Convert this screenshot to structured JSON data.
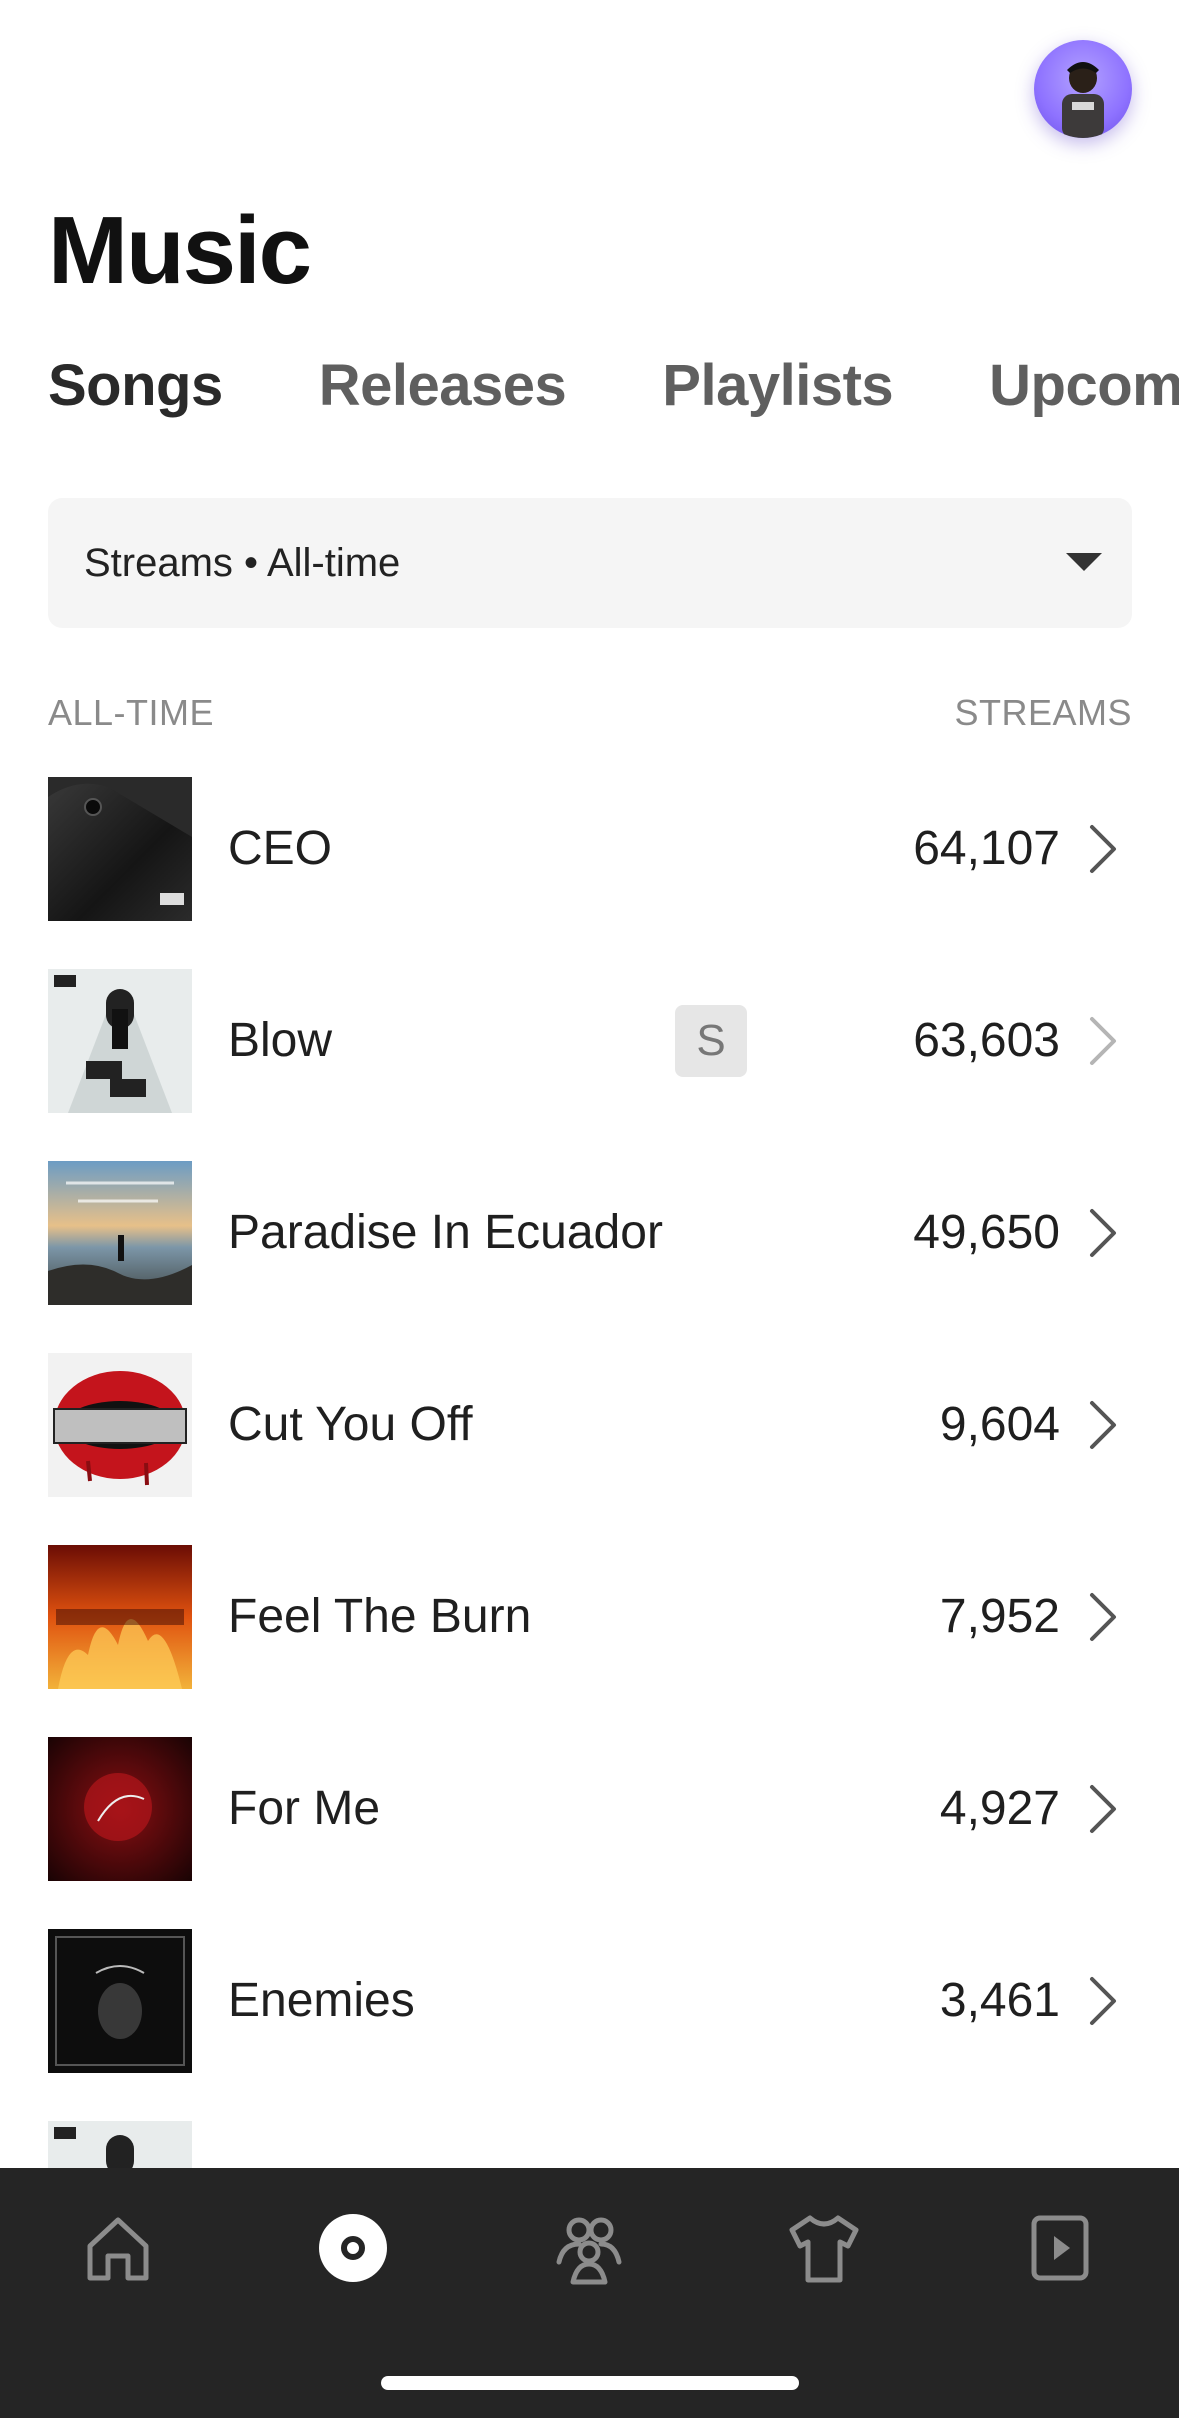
{
  "header": {
    "title": "Music",
    "avatar_icon": "user-avatar"
  },
  "tabs": [
    {
      "label": "Songs",
      "active": true
    },
    {
      "label": "Releases",
      "active": false
    },
    {
      "label": "Playlists",
      "active": false
    },
    {
      "label": "Upcoming",
      "active": false
    }
  ],
  "filter": {
    "selected": "Streams • All-time",
    "icon": "caret-down-icon"
  },
  "list_header": {
    "left": "ALL-TIME",
    "right": "STREAMS"
  },
  "songs": [
    {
      "title": "CEO",
      "streams": "64,107"
    },
    {
      "title": "Blow",
      "streams": "63,603",
      "badge": "S"
    },
    {
      "title": "Paradise In Ecuador",
      "streams": "49,650"
    },
    {
      "title": "Cut You Off",
      "streams": "9,604"
    },
    {
      "title": "Feel The Burn",
      "streams": "7,952"
    },
    {
      "title": "For Me",
      "streams": "4,927"
    },
    {
      "title": "Enemies",
      "streams": "3,461"
    }
  ],
  "nav": [
    "home-icon",
    "music-disc-icon",
    "audience-icon",
    "merch-shirt-icon",
    "video-play-icon"
  ],
  "colors": {
    "nav_bg": "#252525",
    "accent_avatar": "#8e72ff"
  }
}
